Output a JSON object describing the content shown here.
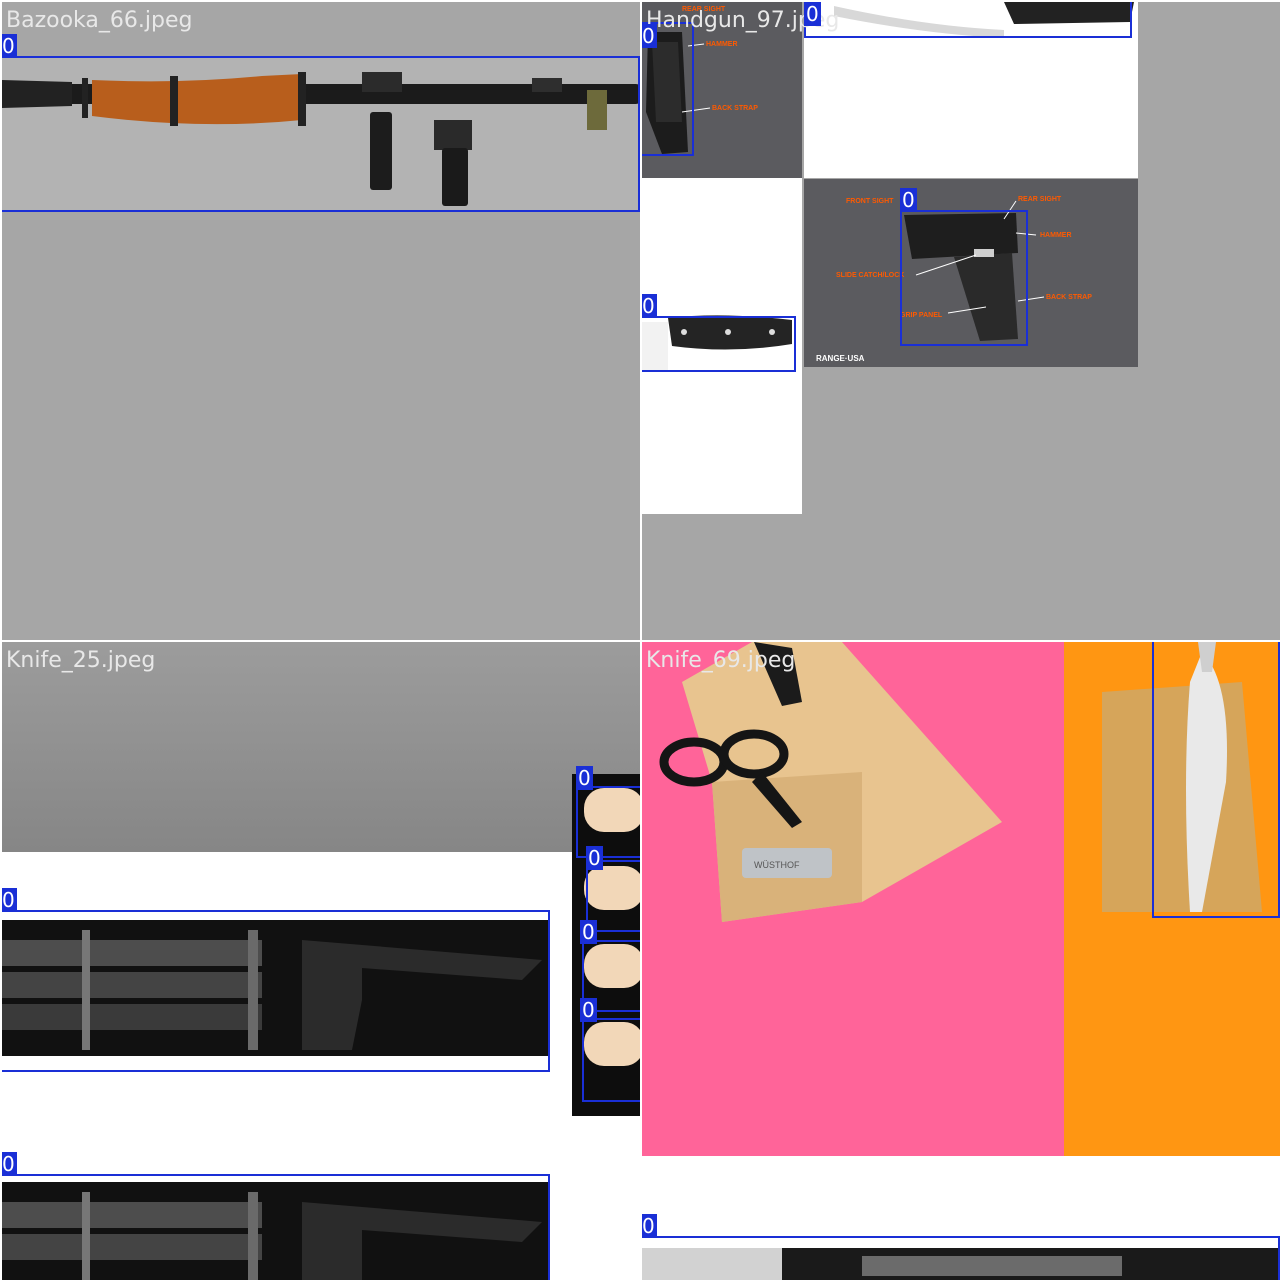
{
  "tiles": [
    {
      "filename": "Bazooka_66.jpeg"
    },
    {
      "filename": "Handgun_97.jpeg"
    },
    {
      "filename": "Knife_25.jpeg"
    },
    {
      "filename": "Knife_69.jpeg"
    }
  ],
  "detection_label": "0",
  "handgun_callouts": {
    "front_sight": "FRONT SIGHT",
    "rear_sight": "REAR SIGHT",
    "hammer": "HAMMER",
    "slide_catch": "SLIDE CATCH/LOCK",
    "back_strap": "BACK STRAP",
    "grip_panel": "GRIP PANEL",
    "brand": "RANGE·USA"
  },
  "knife_block_brand": "WÜSTHOF",
  "colors": {
    "box": "#1a2fd6",
    "bazooka_bg": "#a6a6a6",
    "handgun_bg": "#5b5b5f",
    "pink": "#ff6499",
    "orange": "#ff9612"
  }
}
